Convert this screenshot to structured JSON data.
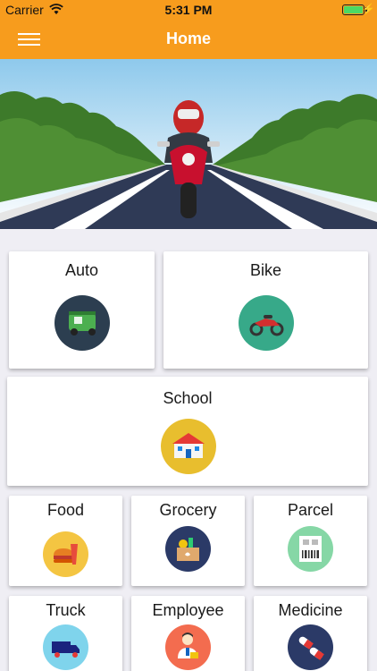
{
  "status_bar": {
    "carrier": "Carrier",
    "time": "5:31 PM"
  },
  "nav": {
    "title": "Home"
  },
  "services": [
    {
      "label": "Auto",
      "icon": "auto-rickshaw-icon",
      "color": "#2c3e50"
    },
    {
      "label": "Bike",
      "icon": "motorbike-icon",
      "color": "#37a989"
    },
    {
      "label": "School",
      "icon": "school-building-icon",
      "color": "#e8be2e"
    },
    {
      "label": "Food",
      "icon": "food-icon",
      "color": "#f4c542"
    },
    {
      "label": "Grocery",
      "icon": "grocery-bag-icon",
      "color": "#2b3a67"
    },
    {
      "label": "Parcel",
      "icon": "parcel-label-icon",
      "color": "#86d7a6"
    },
    {
      "label": "Truck",
      "icon": "truck-icon",
      "color": "#7fd4ec"
    },
    {
      "label": "Employee",
      "icon": "employee-icon",
      "color": "#f36c4f"
    },
    {
      "label": "Medicine",
      "icon": "medicine-pills-icon",
      "color": "#2b3a67"
    }
  ],
  "colors": {
    "accent": "#f79c1d",
    "background": "#efeef4"
  }
}
